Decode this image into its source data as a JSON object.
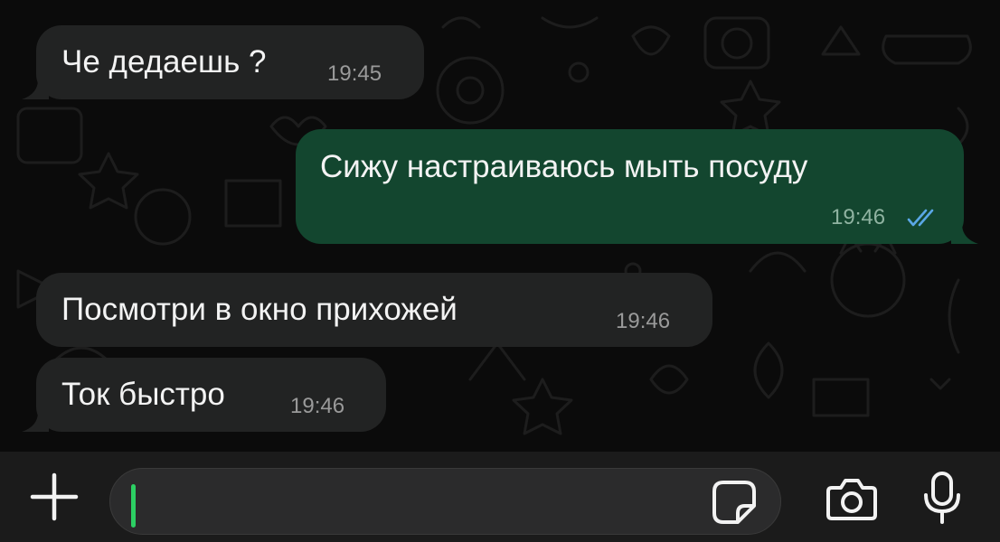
{
  "chat": {
    "messages": [
      {
        "direction": "incoming",
        "text": "Че дедаешь ?",
        "time": "19:45"
      },
      {
        "direction": "outgoing",
        "text": "Сижу настраиваюсь мыть посуду",
        "time": "19:46",
        "status": "read"
      },
      {
        "direction": "incoming",
        "text": "Посмотри в окно прихожей",
        "time": "19:46"
      },
      {
        "direction": "incoming",
        "text": "Ток быстро",
        "time": "19:46"
      }
    ]
  },
  "input_bar": {
    "attach_icon": "plus-icon",
    "message_value": "",
    "sticker_icon": "sticker-icon",
    "camera_icon": "camera-icon",
    "mic_icon": "microphone-icon"
  },
  "colors": {
    "incoming_bubble": "#222323",
    "outgoing_bubble": "#13462f",
    "read_checks": "#5aa7e6",
    "caret": "#2ccf63",
    "background": "#0b0b0b"
  }
}
